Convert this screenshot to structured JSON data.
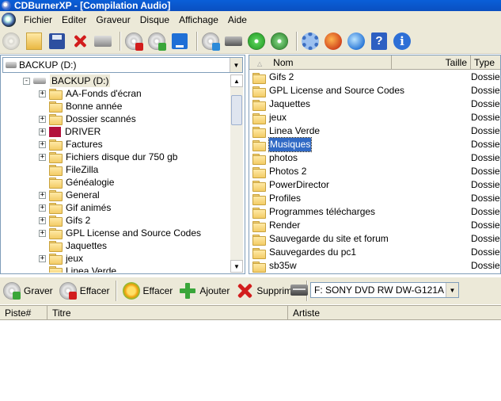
{
  "window": {
    "title": "CDBurnerXP - [Compilation Audio]"
  },
  "menu": [
    "Fichier",
    "Editer",
    "Graveur",
    "Disque",
    "Affichage",
    "Aide"
  ],
  "toolbar_icons": [
    "new-compilation-icon",
    "open-folder-icon",
    "save-icon",
    "delete-icon",
    "print-icon",
    "erase-disc-icon",
    "burn-disc-icon",
    "save-blue-icon",
    "disc-info-icon",
    "drive-info-icon",
    "disc-green-icon",
    "disc-star-icon",
    "settings-gear-icon",
    "web-globe-icon",
    "cursor-globe-icon",
    "help-icon",
    "info-icon"
  ],
  "left_pane": {
    "drive_selector": "BACKUP (D:)",
    "tree": [
      {
        "label": "BACKUP (D:)",
        "expander": "-",
        "icon": "drive",
        "level": 0,
        "selected": true
      },
      {
        "label": "AA-Fonds d'écran",
        "expander": "+",
        "icon": "folder",
        "level": 1
      },
      {
        "label": "Bonne année",
        "expander": "",
        "icon": "folder",
        "level": 1
      },
      {
        "label": "Dossier scannés",
        "expander": "+",
        "icon": "folder",
        "level": 1
      },
      {
        "label": "DRIVER",
        "expander": "+",
        "icon": "driver",
        "level": 1
      },
      {
        "label": "Factures",
        "expander": "+",
        "icon": "folder",
        "level": 1
      },
      {
        "label": "Fichiers disque dur 750 gb",
        "expander": "+",
        "icon": "folder",
        "level": 1
      },
      {
        "label": "FileZilla",
        "expander": "",
        "icon": "folder",
        "level": 1
      },
      {
        "label": "Généalogie",
        "expander": "",
        "icon": "folder",
        "level": 1
      },
      {
        "label": "General",
        "expander": "+",
        "icon": "folder",
        "level": 1
      },
      {
        "label": "Gif animés",
        "expander": "+",
        "icon": "folder",
        "level": 1
      },
      {
        "label": "Gifs 2",
        "expander": "+",
        "icon": "folder",
        "level": 1
      },
      {
        "label": "GPL License and Source Codes",
        "expander": "+",
        "icon": "folder",
        "level": 1
      },
      {
        "label": "Jaquettes",
        "expander": "",
        "icon": "folder",
        "level": 1
      },
      {
        "label": "jeux",
        "expander": "+",
        "icon": "folder",
        "level": 1
      },
      {
        "label": "Linea Verde",
        "expander": "",
        "icon": "folder",
        "level": 1
      }
    ]
  },
  "right_pane": {
    "columns": {
      "name": "Nom",
      "size": "Taille",
      "type": "Type"
    },
    "rows": [
      {
        "name": "Gifs 2",
        "type": "Dossier"
      },
      {
        "name": "GPL License and Source Codes",
        "type": "Dossier"
      },
      {
        "name": "Jaquettes",
        "type": "Dossier"
      },
      {
        "name": "jeux",
        "type": "Dossier"
      },
      {
        "name": "Linea Verde",
        "type": "Dossier"
      },
      {
        "name": "Musiques",
        "type": "Dossier",
        "selected": true
      },
      {
        "name": "photos",
        "type": "Dossier"
      },
      {
        "name": "Photos 2",
        "type": "Dossier"
      },
      {
        "name": "PowerDirector",
        "type": "Dossier"
      },
      {
        "name": "Profiles",
        "type": "Dossier"
      },
      {
        "name": "Programmes télécharges",
        "type": "Dossier"
      },
      {
        "name": "Render",
        "type": "Dossier"
      },
      {
        "name": "Sauvegarde du site et forum",
        "type": "Dossier"
      },
      {
        "name": "Sauvegardes du pc1",
        "type": "Dossier"
      },
      {
        "name": "sb35w",
        "type": "Dossier"
      }
    ]
  },
  "bottom_toolbar": {
    "burn": "Graver",
    "erase": "Effacer",
    "clear": "Effacer",
    "add": "Ajouter",
    "remove": "Supprimer",
    "recorder": "F: SONY DVD RW DW-G121A"
  },
  "track_list": {
    "columns": [
      "Piste#",
      "Titre",
      "Artiste"
    ]
  },
  "colors": {
    "title_bar": "#0a5fd8",
    "selection": "#316ac5",
    "chrome": "#ece9d8"
  }
}
